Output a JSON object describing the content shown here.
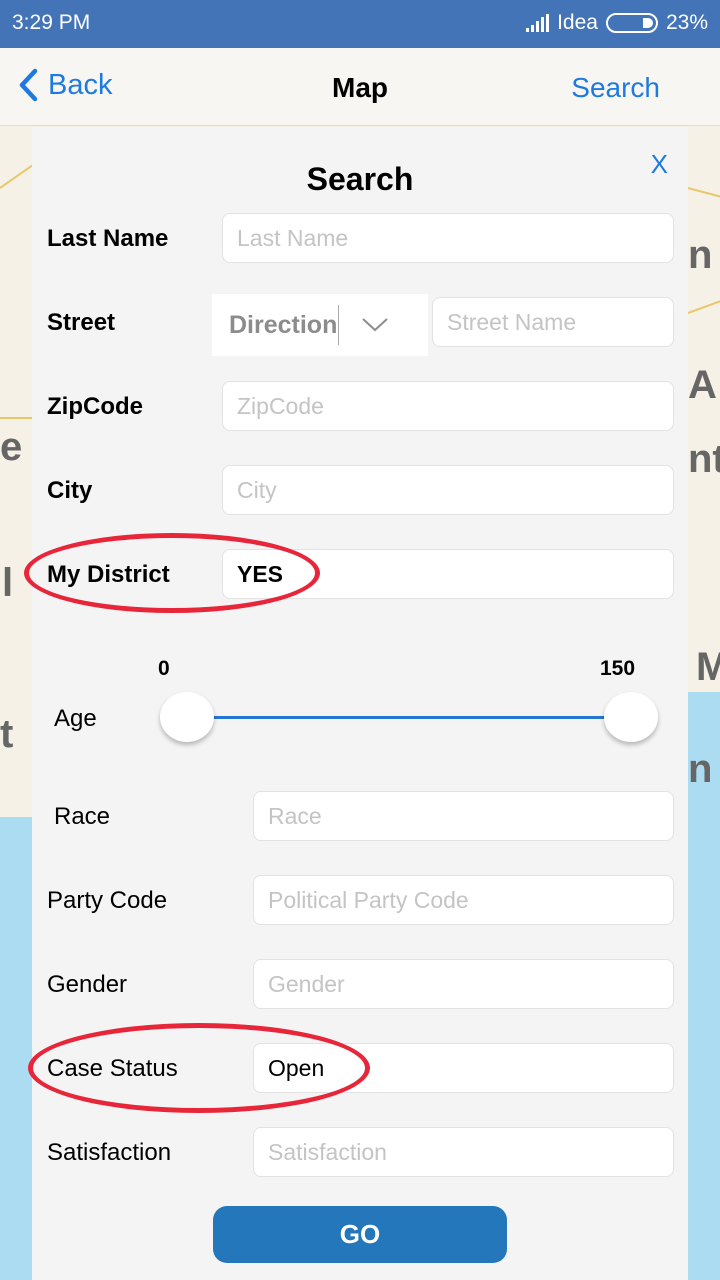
{
  "status_bar": {
    "time": "3:29 PM",
    "carrier": "Idea",
    "battery": "23%",
    "icons": [
      "signal-icon",
      "battery-icon"
    ]
  },
  "nav": {
    "back_label": "Back",
    "title": "Map",
    "search_label": "Search"
  },
  "map": {
    "labels": [
      "n",
      "A",
      "nt",
      "e",
      "l",
      "M",
      "t",
      "n"
    ]
  },
  "modal": {
    "title": "Search",
    "close_label": "X",
    "fields": {
      "last_name": {
        "label": "Last Name",
        "placeholder": "Last Name",
        "value": ""
      },
      "street": {
        "label": "Street",
        "direction_value": "Direction",
        "placeholder": "Street Name",
        "value": ""
      },
      "zipcode": {
        "label": "ZipCode",
        "placeholder": "ZipCode",
        "value": ""
      },
      "city": {
        "label": "City",
        "placeholder": "City",
        "value": ""
      },
      "my_district": {
        "label": "My District",
        "value": "YES"
      },
      "age": {
        "label": "Age",
        "min_label": "0",
        "max_label": "150",
        "min": 0,
        "max": 150,
        "low": 0,
        "high": 150
      },
      "race": {
        "label": "Race",
        "placeholder": "Race",
        "value": ""
      },
      "party_code": {
        "label": "Party Code",
        "placeholder": "Political Party Code",
        "value": ""
      },
      "gender": {
        "label": "Gender",
        "placeholder": "Gender",
        "value": ""
      },
      "case_status": {
        "label": "Case Status",
        "value": "Open"
      },
      "satisfaction": {
        "label": "Satisfaction",
        "placeholder": "Satisfaction",
        "value": ""
      }
    },
    "go_label": "GO"
  },
  "annotations": {
    "color": "#e8263a",
    "highlighted": [
      "My District",
      "Case Status"
    ]
  },
  "colors": {
    "status_bar": "#4374b8",
    "accent": "#1e7ae0",
    "go_button": "#2477ba",
    "water": "#acdcf2"
  }
}
